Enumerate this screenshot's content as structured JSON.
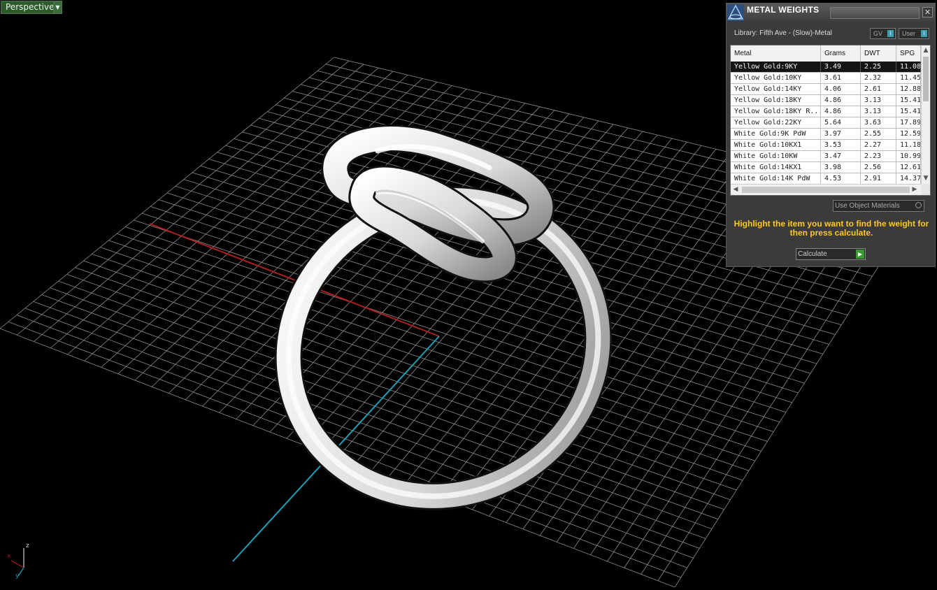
{
  "viewport": {
    "view_label": "Perspective",
    "axis_labels": [
      "z",
      "x",
      "y"
    ]
  },
  "panel": {
    "title": "METAL WEIGHTS",
    "library": "Library: Fifth Ave - (Slow)-Metal",
    "gv_label": "GV",
    "user_label": "User",
    "columns": [
      "Metal",
      "Grams",
      "DWT",
      "SPG"
    ],
    "rows": [
      {
        "metal": "Yellow Gold:9KY",
        "grams": "3.49",
        "dwt": "2.25",
        "spg": "11.08"
      },
      {
        "metal": "Yellow Gold:10KY",
        "grams": "3.61",
        "dwt": "2.32",
        "spg": "11.45"
      },
      {
        "metal": "Yellow Gold:14KY",
        "grams": "4.06",
        "dwt": "2.61",
        "spg": "12.88"
      },
      {
        "metal": "Yellow Gold:18KY",
        "grams": "4.86",
        "dwt": "3.13",
        "spg": "15.41"
      },
      {
        "metal": "Yellow Gold:18KY R...",
        "grams": "4.86",
        "dwt": "3.13",
        "spg": "15.41"
      },
      {
        "metal": "Yellow Gold:22KY",
        "grams": "5.64",
        "dwt": "3.63",
        "spg": "17.89"
      },
      {
        "metal": "White Gold:9K PdW",
        "grams": "3.97",
        "dwt": "2.55",
        "spg": "12.59"
      },
      {
        "metal": "White Gold:10KX1",
        "grams": "3.53",
        "dwt": "2.27",
        "spg": "11.18"
      },
      {
        "metal": "White Gold:10KW",
        "grams": "3.47",
        "dwt": "2.23",
        "spg": "10.99"
      },
      {
        "metal": "White Gold:14KX1",
        "grams": "3.98",
        "dwt": "2.56",
        "spg": "12.61"
      },
      {
        "metal": "White Gold:14K PdW",
        "grams": "4.53",
        "dwt": "2.91",
        "spg": "14.37"
      }
    ],
    "use_object_materials": "Use Object Materials",
    "hint": "Highlight the item you want to find the weight for then press calculate.",
    "calculate_label": "Calculate"
  },
  "colors": {
    "viewport_bg": "#000000",
    "grid_line": "#8c8c8c",
    "x_axis": "#b01e1e",
    "y_axis": "#1aa0b8",
    "hint_text": "#ffc820",
    "selected_row": "#151515",
    "calc_arrow": "#3a9a30"
  }
}
